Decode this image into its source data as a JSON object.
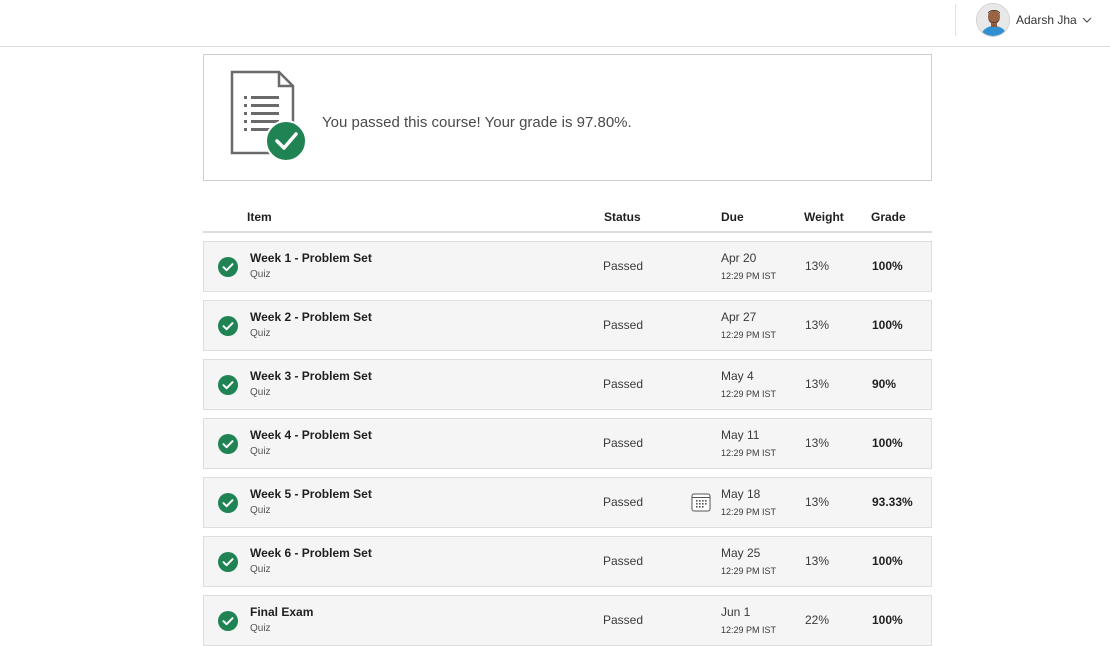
{
  "user": {
    "name": "Adarsh Jha"
  },
  "banner": {
    "message": "You passed this course! Your grade is 97.80%."
  },
  "table": {
    "headers": {
      "item": "Item",
      "status": "Status",
      "due": "Due",
      "weight": "Weight",
      "grade": "Grade"
    },
    "rows": [
      {
        "title": "Week 1 - Problem Set",
        "type": "Quiz",
        "status": "Passed",
        "due_date": "Apr 20",
        "due_time": "12:29 PM IST",
        "weight": "13%",
        "grade": "100%"
      },
      {
        "title": "Week 2 - Problem Set",
        "type": "Quiz",
        "status": "Passed",
        "due_date": "Apr 27",
        "due_time": "12:29 PM IST",
        "weight": "13%",
        "grade": "100%"
      },
      {
        "title": "Week 3 - Problem Set",
        "type": "Quiz",
        "status": "Passed",
        "due_date": "May 4",
        "due_time": "12:29 PM IST",
        "weight": "13%",
        "grade": "90%"
      },
      {
        "title": "Week 4 - Problem Set",
        "type": "Quiz",
        "status": "Passed",
        "due_date": "May 11",
        "due_time": "12:29 PM IST",
        "weight": "13%",
        "grade": "100%"
      },
      {
        "title": "Week 5 - Problem Set",
        "type": "Quiz",
        "status": "Passed",
        "due_date": "May 18",
        "due_time": "12:29 PM IST",
        "weight": "13%",
        "grade": "93.33%"
      },
      {
        "title": "Week 6 - Problem Set",
        "type": "Quiz",
        "status": "Passed",
        "due_date": "May 25",
        "due_time": "12:29 PM IST",
        "weight": "13%",
        "grade": "100%"
      },
      {
        "title": "Final Exam",
        "type": "Quiz",
        "status": "Passed",
        "due_date": "Jun 1",
        "due_time": "12:29 PM IST",
        "weight": "22%",
        "grade": "100%"
      }
    ]
  },
  "colors": {
    "success_green": "#1f8354",
    "row_background": "#f5f5f5",
    "border": "#dedede"
  },
  "icons": {
    "passed": "check-circle-icon",
    "calendar": "calendar-icon",
    "document": "document-check-icon",
    "dropdown": "chevron-down-icon"
  }
}
